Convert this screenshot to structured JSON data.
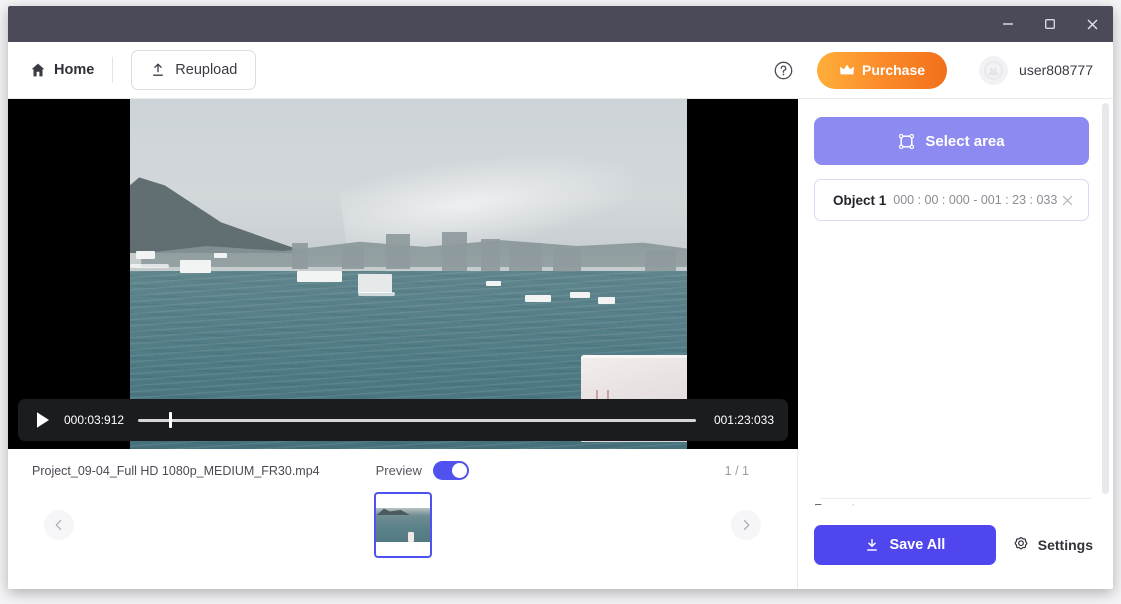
{
  "window": {
    "controls": {
      "minimize": "minimize-icon",
      "maximize": "maximize-icon",
      "close": "close-icon"
    }
  },
  "toolbar": {
    "home_label": "Home",
    "home_icon": "home-icon",
    "reupload_label": "Reupload",
    "reupload_icon": "upload-icon",
    "help_icon": "help-circle-icon",
    "purchase_label": "Purchase",
    "purchase_icon": "crown-icon",
    "purchase_color_start": "#ffae3a",
    "purchase_color_end": "#f2701b",
    "username": "user808777",
    "avatar_icon": "user-avatar-icon"
  },
  "player": {
    "play_icon": "play-icon",
    "current_time": "000:03:912",
    "duration": "001:23:033",
    "progress_percent": 5.5
  },
  "filmstrip": {
    "filename": "Project_09-04_Full HD 1080p_MEDIUM_FR30.mp4",
    "preview_label": "Preview",
    "preview_on": true,
    "page_indicator": "1 / 1",
    "prev_icon": "chevron-left-icon",
    "next_icon": "chevron-right-icon",
    "thumbnail_selected": true
  },
  "right_panel": {
    "select_area_label": "Select area",
    "select_area_icon": "crop-select-icon",
    "select_area_color": "#8d8bf2",
    "objects": [
      {
        "name": "Object 1",
        "range": "000 : 00 : 000 - 001 : 23 : 033",
        "close_icon": "close-icon"
      }
    ],
    "format_label": "Format :",
    "save_all_label": "Save All",
    "save_all_icon": "download-icon",
    "save_all_color": "#4f47ed",
    "settings_label": "Settings",
    "settings_icon": "gear-icon"
  }
}
